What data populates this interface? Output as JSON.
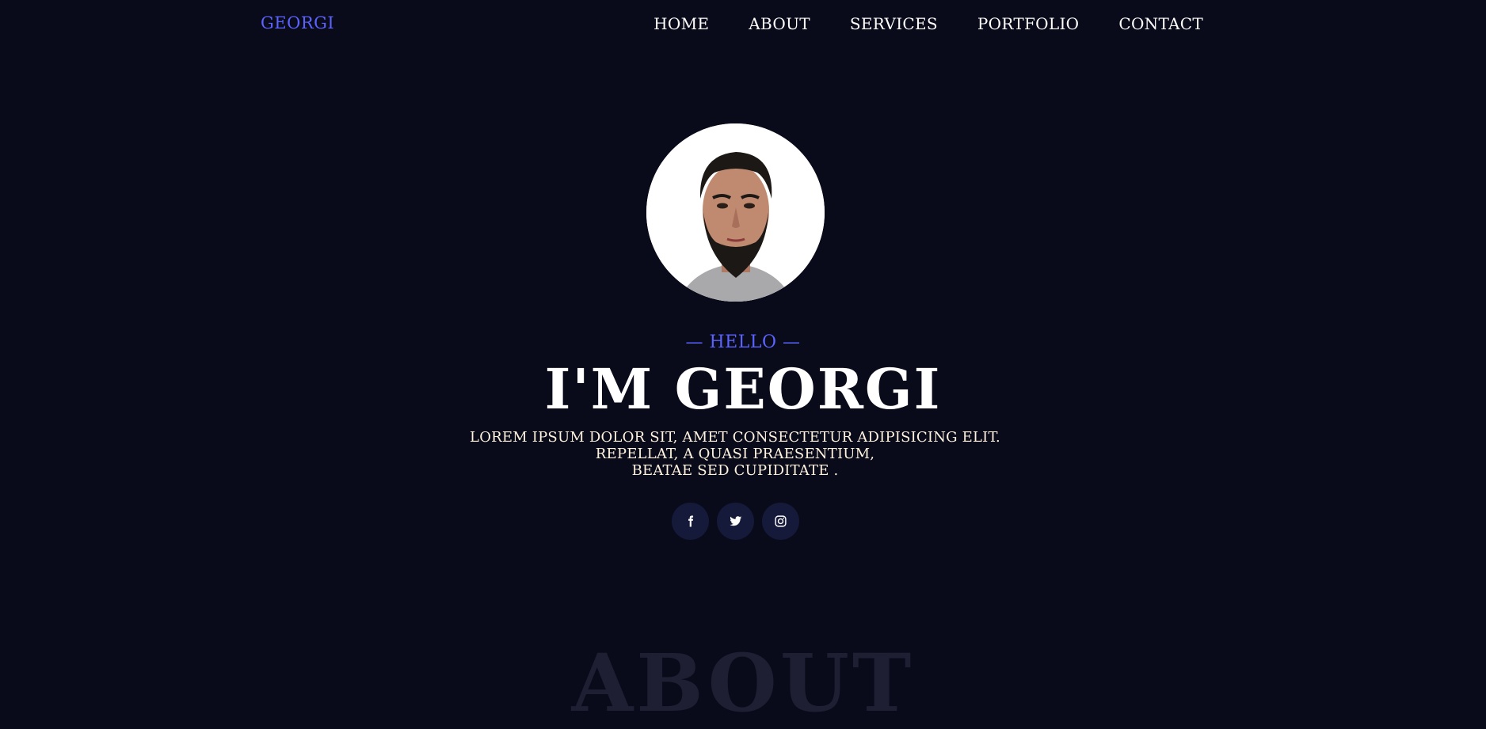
{
  "brand": {
    "name": "GEORGI",
    "color": "#5b63ff"
  },
  "nav": {
    "items": [
      {
        "label": "HOME"
      },
      {
        "label": "ABOUT"
      },
      {
        "label": "SERVICES"
      },
      {
        "label": "PORTFOLIO"
      },
      {
        "label": "CONTACT"
      }
    ]
  },
  "hero": {
    "avatar_icon": "profile-photo",
    "hello": "— HELLO —",
    "headline": "I'M GEORGI",
    "intro_line1": "LOREM IPSUM DOLOR SIT, AMET CONSECTETUR ADIPISICING ELIT. REPELLAT, A QUASI PRAESENTIUM,",
    "intro_line2": "BEATAE SED CUPIDITATE ."
  },
  "socials": [
    {
      "icon": "facebook-icon"
    },
    {
      "icon": "twitter-icon"
    },
    {
      "icon": "instagram-icon"
    }
  ],
  "about_section": {
    "title": "ABOUT"
  },
  "colors": {
    "background": "#0a0b1a",
    "accent": "#5b63ff",
    "social_bg": "#161a3a",
    "ghost_heading": "#1f1f33"
  }
}
